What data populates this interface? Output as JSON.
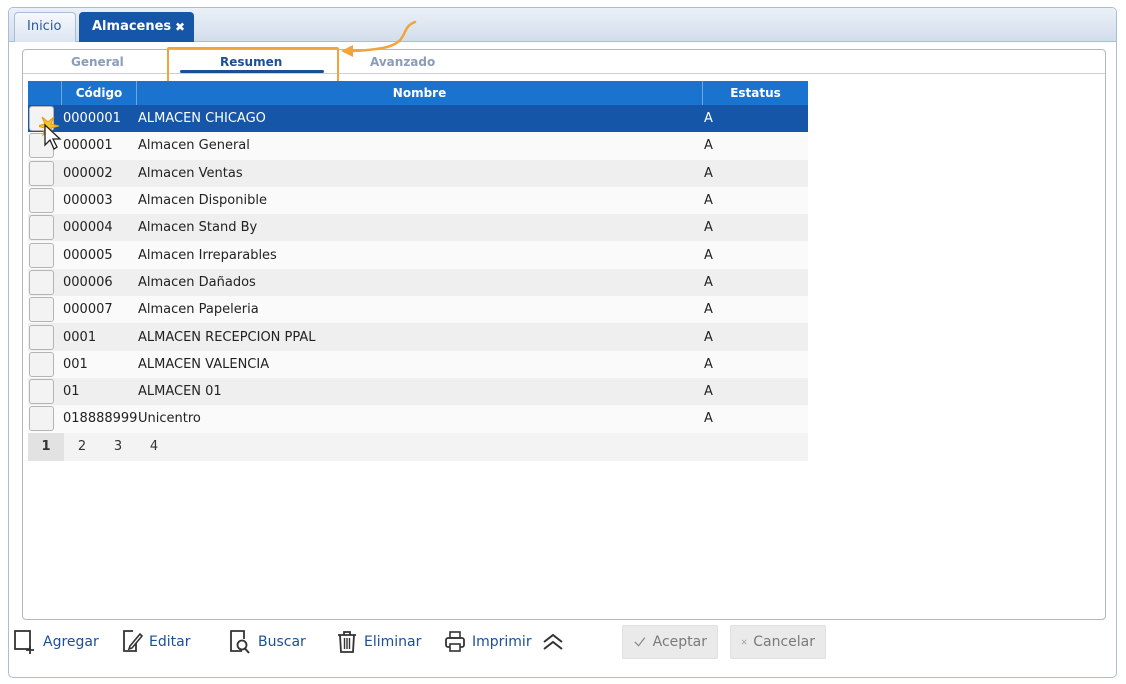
{
  "tabs": {
    "inicio": "Inicio",
    "almacenes": "Almacenes",
    "close_glyph": "✖"
  },
  "subtabs": {
    "general": "General",
    "resumen": "Resumen",
    "avanzado": "Avanzado"
  },
  "grid": {
    "headers": {
      "code": "Código",
      "name": "Nombre",
      "status": "Estatus"
    },
    "rows": [
      {
        "code": "0000001",
        "name": "ALMACEN CHICAGO",
        "status": "A"
      },
      {
        "code": "000001",
        "name": "Almacen General",
        "status": "A"
      },
      {
        "code": "000002",
        "name": "Almacen Ventas",
        "status": "A"
      },
      {
        "code": "000003",
        "name": "Almacen Disponible",
        "status": "A"
      },
      {
        "code": "000004",
        "name": "Almacen Stand By",
        "status": "A"
      },
      {
        "code": "000005",
        "name": "Almacen Irreparables",
        "status": "A"
      },
      {
        "code": "000006",
        "name": "Almacen Dañados",
        "status": "A"
      },
      {
        "code": "000007",
        "name": "Almacen Papeleria",
        "status": "A"
      },
      {
        "code": "0001",
        "name": "ALMACEN RECEPCION PPAL",
        "status": "A"
      },
      {
        "code": "001",
        "name": "ALMACEN VALENCIA",
        "status": "A"
      },
      {
        "code": "01",
        "name": "ALMACEN 01",
        "status": "A"
      },
      {
        "code": "018888999",
        "name": "Unicentro",
        "status": "A"
      }
    ],
    "pages": [
      "1",
      "2",
      "3",
      "4"
    ]
  },
  "toolbar": {
    "agregar": "Agregar",
    "editar": "Editar",
    "buscar": "Buscar",
    "eliminar": "Eliminar",
    "imprimir": "Imprimir",
    "aceptar": "Aceptar",
    "cancelar": "Cancelar"
  },
  "colors": {
    "accent": "#1556a8",
    "header": "#1a73cf",
    "annotation": "#f2a33a"
  }
}
